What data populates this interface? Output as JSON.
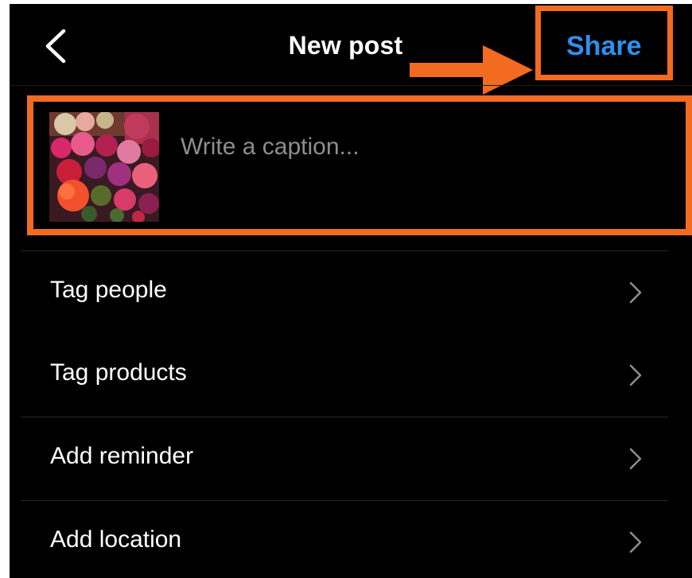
{
  "header": {
    "back_icon": "chevron-left-icon",
    "title": "New post",
    "share_label": "Share"
  },
  "caption": {
    "placeholder": "Write a caption...",
    "value": ""
  },
  "menu": {
    "items": [
      {
        "label": "Tag people",
        "icon": "chevron-right-icon"
      },
      {
        "label": "Tag products",
        "icon": "chevron-right-icon"
      },
      {
        "label": "Add reminder",
        "icon": "chevron-right-icon"
      },
      {
        "label": "Add location",
        "icon": "chevron-right-icon"
      }
    ]
  },
  "colors": {
    "background": "#000000",
    "accent": "#2f8ff0",
    "highlight": "#f26b21",
    "text": "#ffffff",
    "placeholder": "#8e8e8e"
  }
}
